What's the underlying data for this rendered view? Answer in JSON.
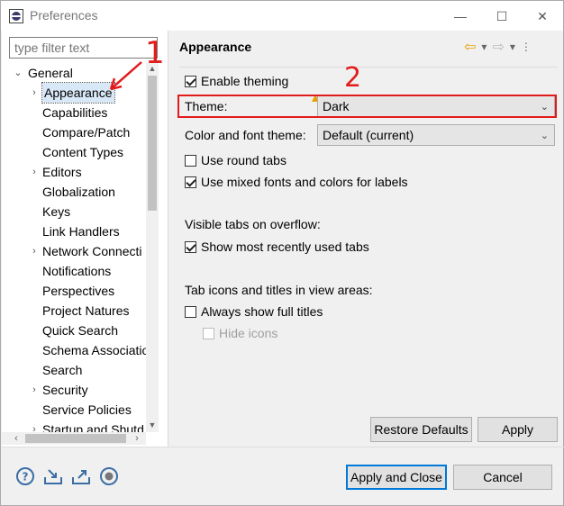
{
  "window": {
    "title": "Preferences",
    "min_glyph": "—",
    "max_glyph": "☐",
    "close_glyph": "✕"
  },
  "filter": {
    "placeholder": "type filter text"
  },
  "tree": {
    "root": "General",
    "items": [
      {
        "label": "Appearance",
        "expandable": true,
        "selected": true
      },
      {
        "label": "Capabilities",
        "expandable": false
      },
      {
        "label": "Compare/Patch",
        "expandable": false
      },
      {
        "label": "Content Types",
        "expandable": false
      },
      {
        "label": "Editors",
        "expandable": true
      },
      {
        "label": "Globalization",
        "expandable": false
      },
      {
        "label": "Keys",
        "expandable": false
      },
      {
        "label": "Link Handlers",
        "expandable": false
      },
      {
        "label": "Network Connecti",
        "expandable": true
      },
      {
        "label": "Notifications",
        "expandable": false
      },
      {
        "label": "Perspectives",
        "expandable": false
      },
      {
        "label": "Project Natures",
        "expandable": false
      },
      {
        "label": "Quick Search",
        "expandable": false
      },
      {
        "label": "Schema Associatio",
        "expandable": false
      },
      {
        "label": "Search",
        "expandable": false
      },
      {
        "label": "Security",
        "expandable": true
      },
      {
        "label": "Service Policies",
        "expandable": false
      },
      {
        "label": "Startup and Shutd",
        "expandable": true
      }
    ]
  },
  "page": {
    "title": "Appearance",
    "enable_theming": {
      "label": "Enable theming",
      "checked": true
    },
    "theme": {
      "label": "Theme:",
      "value": "Dark"
    },
    "color_font_theme": {
      "label": "Color and font theme:",
      "value": "Default (current)"
    },
    "use_round_tabs": {
      "label": "Use round tabs",
      "checked": false
    },
    "use_mixed_fonts": {
      "label": "Use mixed fonts and colors for labels",
      "checked": true
    },
    "visible_tabs_heading": "Visible tabs on overflow:",
    "show_recent_tabs": {
      "label": "Show most recently used tabs",
      "checked": true
    },
    "tab_icons_heading": "Tab icons and titles in view areas:",
    "always_show_titles": {
      "label": "Always show full titles",
      "checked": false
    },
    "hide_icons": {
      "label": "Hide icons",
      "checked": false,
      "disabled": true
    }
  },
  "buttons": {
    "restore_defaults": "Restore Defaults",
    "apply": "Apply",
    "apply_and_close": "Apply and Close",
    "cancel": "Cancel"
  },
  "annotations": {
    "one": "1",
    "two": "2"
  },
  "colors": {
    "annotation_red": "#e21b1b",
    "selection": "#d9e8f7",
    "default_button_border": "#0078d7"
  }
}
